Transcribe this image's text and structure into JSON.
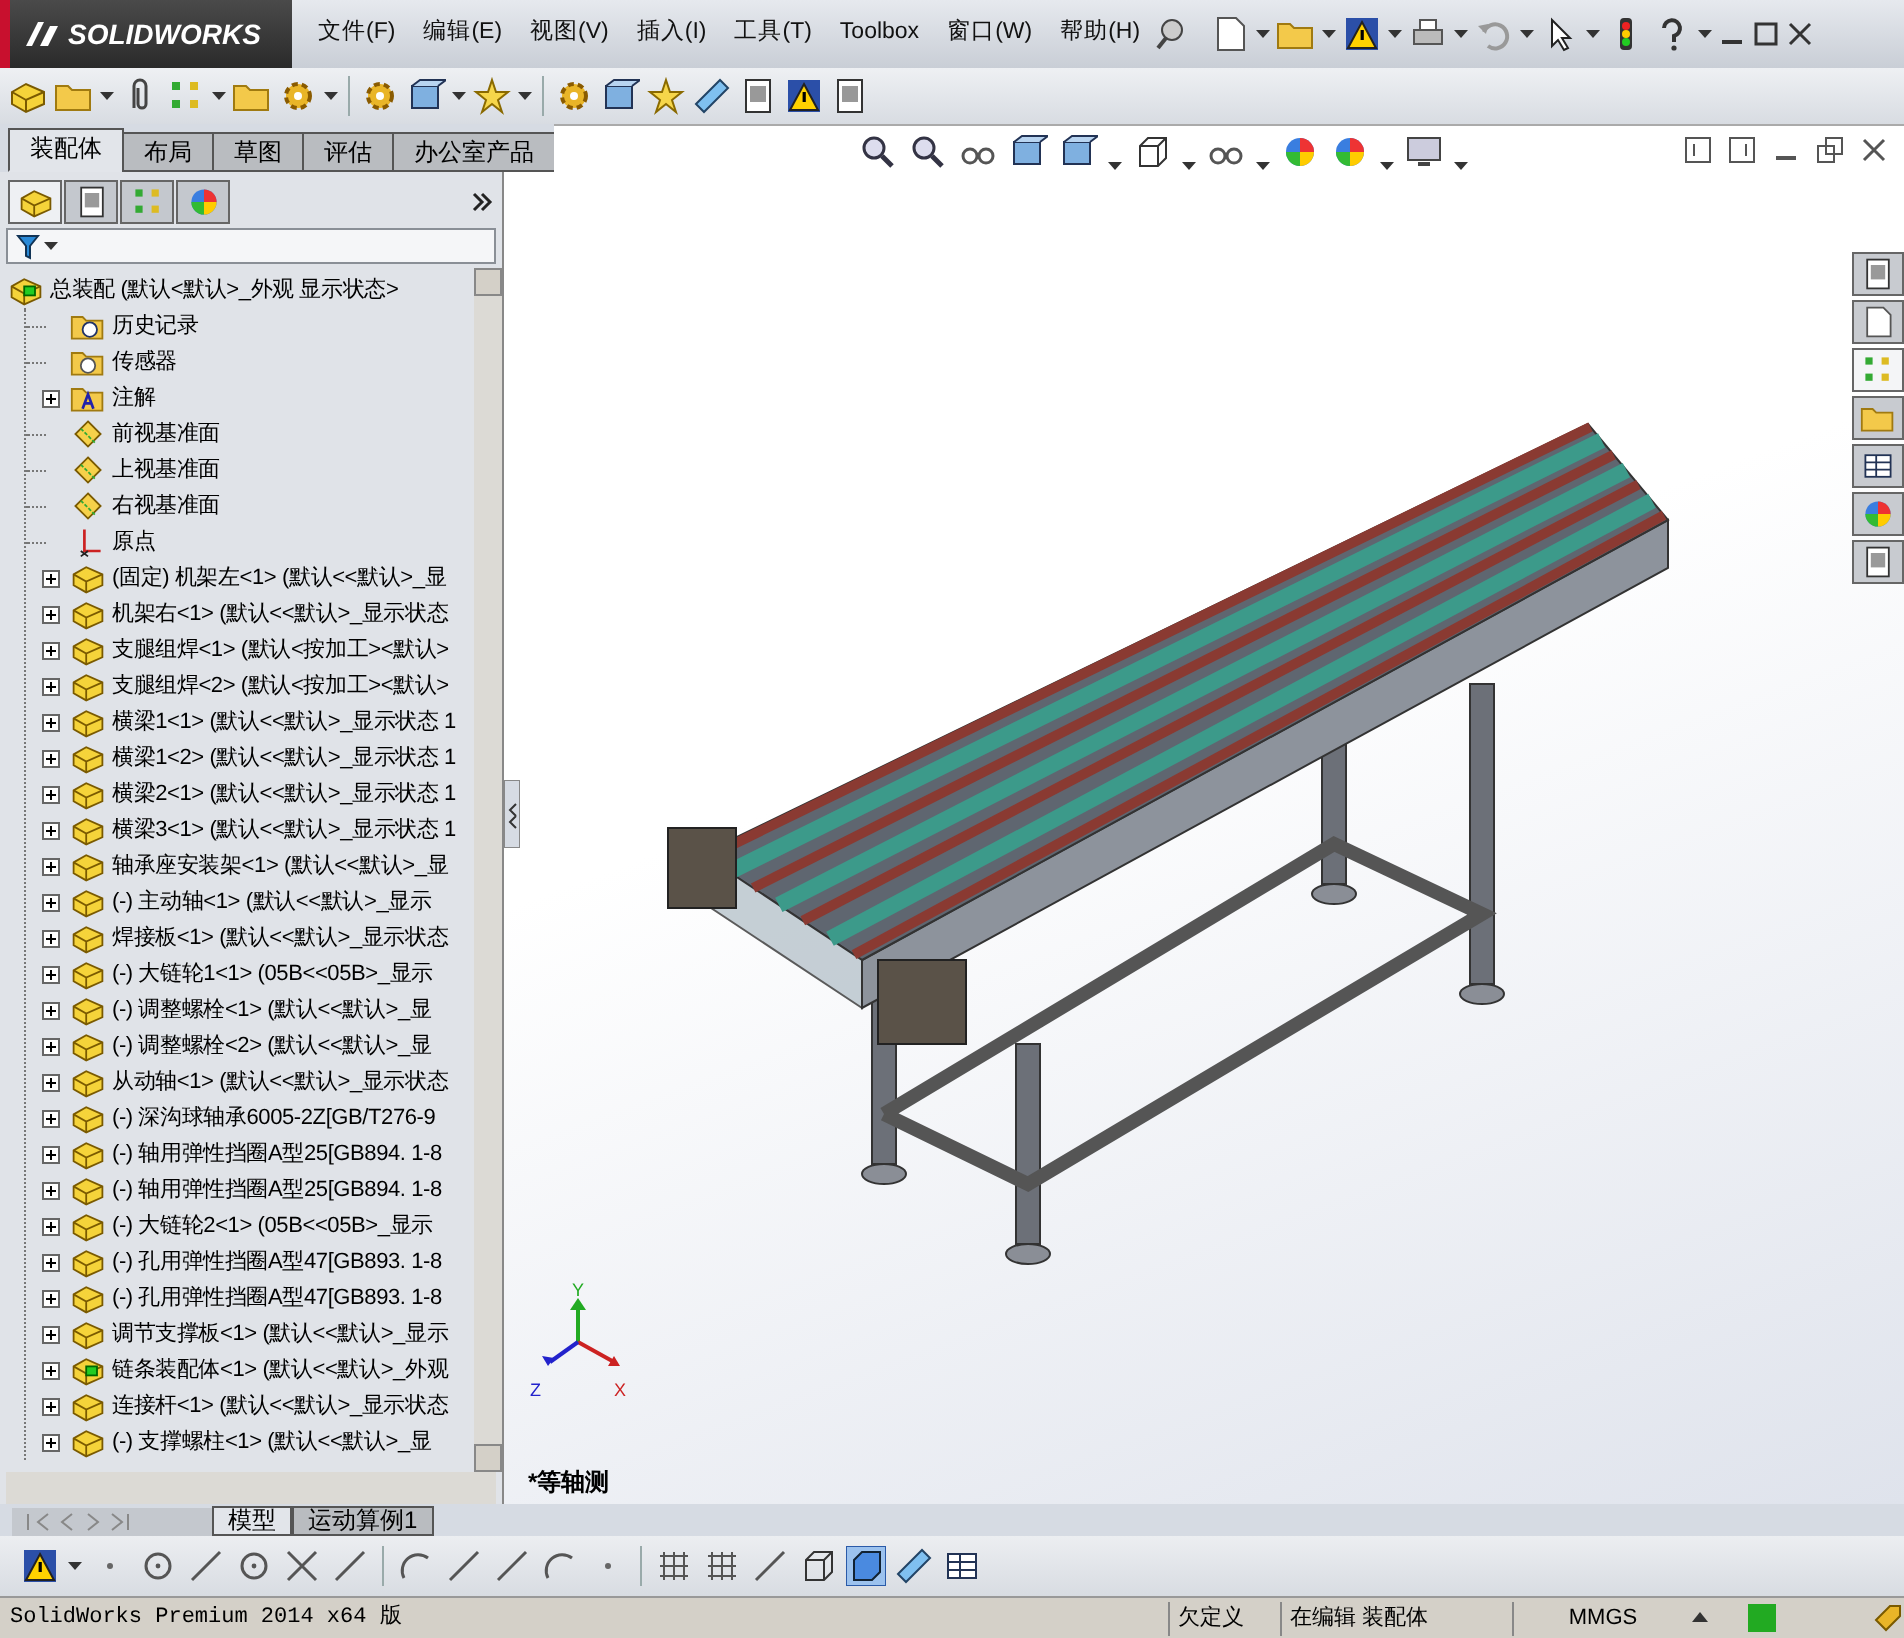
{
  "app": {
    "logo": "SOLIDWORKS"
  },
  "menu": [
    "文件(F)",
    "编辑(E)",
    "视图(V)",
    "插入(I)",
    "工具(T)",
    "Toolbox",
    "窗口(W)",
    "帮助(H)"
  ],
  "command_tabs": [
    {
      "label": "装配体",
      "selected": true
    },
    {
      "label": "布局",
      "selected": false
    },
    {
      "label": "草图",
      "selected": false
    },
    {
      "label": "评估",
      "selected": false
    },
    {
      "label": "办公室产品",
      "selected": false
    }
  ],
  "panel_tabs": [
    {
      "kind": "tree",
      "selected": true
    },
    {
      "kind": "property",
      "selected": false
    },
    {
      "kind": "configuration",
      "selected": false
    },
    {
      "kind": "display",
      "selected": false
    }
  ],
  "tree": {
    "label": "总装配 (默认<默认>_外观 显示状态>",
    "kind": "assembly",
    "children": [
      {
        "label": "历史记录",
        "kind": "history",
        "expandable": false
      },
      {
        "label": "传感器",
        "kind": "sensor",
        "expandable": false
      },
      {
        "label": "注解",
        "kind": "annotation",
        "expandable": true
      },
      {
        "label": "前视基准面",
        "kind": "plane",
        "expandable": false
      },
      {
        "label": "上视基准面",
        "kind": "plane",
        "expandable": false
      },
      {
        "label": "右视基准面",
        "kind": "plane",
        "expandable": false
      },
      {
        "label": "原点",
        "kind": "origin",
        "expandable": false
      },
      {
        "label": "(固定) 机架左<1> (默认<<默认>_显",
        "kind": "part",
        "expandable": true
      },
      {
        "label": "机架右<1> (默认<<默认>_显示状态",
        "kind": "part",
        "expandable": true
      },
      {
        "label": "支腿组焊<1> (默认<按加工><默认>",
        "kind": "part",
        "expandable": true
      },
      {
        "label": "支腿组焊<2> (默认<按加工><默认>",
        "kind": "part",
        "expandable": true
      },
      {
        "label": "横梁1<1> (默认<<默认>_显示状态 1",
        "kind": "part",
        "expandable": true
      },
      {
        "label": "横梁1<2> (默认<<默认>_显示状态 1",
        "kind": "part",
        "expandable": true
      },
      {
        "label": "横梁2<1> (默认<<默认>_显示状态 1",
        "kind": "part",
        "expandable": true
      },
      {
        "label": "横梁3<1> (默认<<默认>_显示状态 1",
        "kind": "part",
        "expandable": true
      },
      {
        "label": "轴承座安装架<1> (默认<<默认>_显",
        "kind": "part",
        "expandable": true
      },
      {
        "label": "(-) 主动轴<1> (默认<<默认>_显示",
        "kind": "part",
        "expandable": true
      },
      {
        "label": "焊接板<1> (默认<<默认>_显示状态",
        "kind": "part",
        "expandable": true
      },
      {
        "label": "(-) 大链轮1<1> (05B<<05B>_显示",
        "kind": "part",
        "expandable": true
      },
      {
        "label": "(-) 调整螺栓<1> (默认<<默认>_显",
        "kind": "part",
        "expandable": true
      },
      {
        "label": "(-) 调整螺栓<2> (默认<<默认>_显",
        "kind": "part",
        "expandable": true
      },
      {
        "label": "从动轴<1> (默认<<默认>_显示状态",
        "kind": "part",
        "expandable": true
      },
      {
        "label": "(-) 深沟球轴承6005-2Z[GB/T276-9",
        "kind": "part",
        "expandable": true
      },
      {
        "label": "(-) 轴用弹性挡圈A型25[GB894. 1-8",
        "kind": "part",
        "expandable": true
      },
      {
        "label": "(-) 轴用弹性挡圈A型25[GB894. 1-8",
        "kind": "part",
        "expandable": true
      },
      {
        "label": "(-) 大链轮2<1> (05B<<05B>_显示",
        "kind": "part",
        "expandable": true
      },
      {
        "label": "(-) 孔用弹性挡圈A型47[GB893. 1-8",
        "kind": "part",
        "expandable": true
      },
      {
        "label": "(-) 孔用弹性挡圈A型47[GB893. 1-8",
        "kind": "part",
        "expandable": true
      },
      {
        "label": "调节支撑板<1> (默认<<默认>_显示",
        "kind": "part",
        "expandable": true
      },
      {
        "label": "链条装配体<1> (默认<<默认>_外观",
        "kind": "subassembly",
        "expandable": true
      },
      {
        "label": "连接杆<1> (默认<<默认>_显示状态",
        "kind": "part",
        "expandable": true
      },
      {
        "label": "(-) 支撑螺柱<1> (默认<<默认>_显",
        "kind": "part",
        "expandable": true
      }
    ]
  },
  "task_pane": [
    {
      "selected": false
    },
    {
      "selected": false
    },
    {
      "selected": true
    },
    {
      "selected": false
    },
    {
      "selected": false
    },
    {
      "selected": false
    },
    {
      "selected": false
    }
  ],
  "bottom_tabs": [
    {
      "label": "模型",
      "selected": true
    },
    {
      "label": "运动算例1",
      "selected": false
    }
  ],
  "viewport": {
    "view_label": "*等轴测",
    "triad": {
      "x": "X",
      "y": "Y",
      "z": "Z"
    }
  },
  "status_bar": {
    "product": "SolidWorks Premium 2014 x64 版",
    "state": "欠定义",
    "mode": "在编辑 装配体",
    "units": "MMGS"
  }
}
